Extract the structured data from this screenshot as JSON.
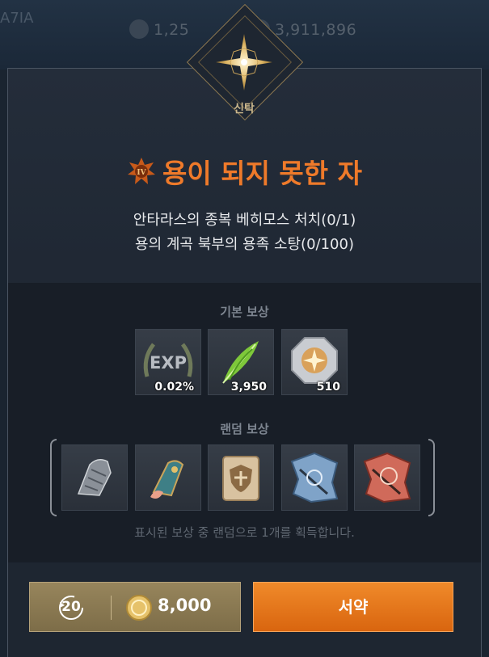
{
  "topbar": {
    "resource1": "1,25",
    "resource2": "3,911,896",
    "left_label": "A7IA"
  },
  "emblem": {
    "label": "신탁"
  },
  "quest": {
    "title": "용이 되지 못한 자",
    "badge_numeral": "IV",
    "objectives": [
      "안타라스의 종복 베히모스 처치(0/1)",
      "용의 계곡 북부의 용족 소탕(0/100)"
    ]
  },
  "basic_reward": {
    "title": "기본 보상",
    "items": [
      {
        "icon": "exp-laurel-icon",
        "amount": "0.02%"
      },
      {
        "icon": "green-feather-icon",
        "amount": "3,950"
      },
      {
        "icon": "octagon-medal-icon",
        "amount": "510"
      }
    ]
  },
  "random_reward": {
    "title": "랜덤 보상",
    "items": [
      {
        "icon": "steel-gauntlet-icon"
      },
      {
        "icon": "ornate-bracer-icon"
      },
      {
        "icon": "shield-scroll-icon"
      },
      {
        "icon": "blue-torn-scroll-icon"
      },
      {
        "icon": "red-torn-scroll-icon"
      }
    ],
    "notice": "표시된 보상 중 랜덤으로 1개를 획득합니다."
  },
  "actions": {
    "refresh_count": "20",
    "cost": "8,000",
    "pledge_label": "서약"
  },
  "colors": {
    "accent_orange": "#ef7a2a",
    "gold": "#c9b68c"
  }
}
